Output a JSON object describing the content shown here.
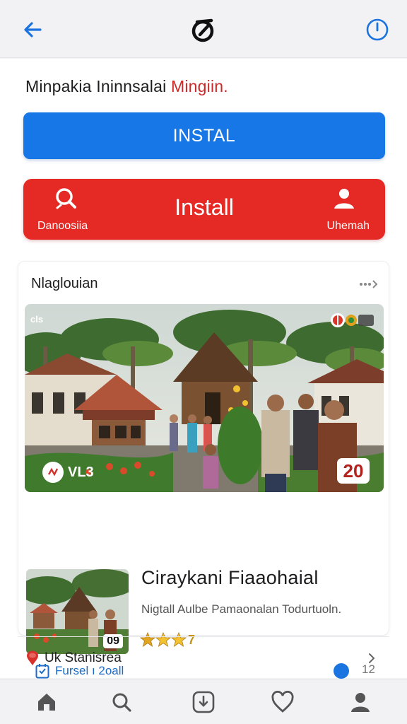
{
  "header": {
    "back_icon": "arrow-left-icon",
    "logo_icon": "brand-logo-icon",
    "power_icon": "power-icon",
    "accent_color": "#1877e6"
  },
  "headline": {
    "text": "Minpakia Ininnsalai",
    "accent": "Mingiin."
  },
  "install_primary": {
    "label": "INSTAL"
  },
  "install_secondary": {
    "label": "Install",
    "left_label": "Danoosiia",
    "right_label": "Uhemah",
    "left_icon": "search-icon",
    "right_icon": "user-icon",
    "color": "#e52a25"
  },
  "card": {
    "title": "Nlaglouian",
    "more_icon": "more-icon",
    "hero": {
      "badge_left": "VL3",
      "badge_right": "20",
      "corner_left": "cls"
    },
    "item": {
      "title": "Ciraykani Fiaaohaial",
      "subtitle": "Nigtall Aulbe Pamaonalan Todurtuoln.",
      "rating_text": "7",
      "stars": 3,
      "thumb_label": "09",
      "date_label": "Fursel ı 2oall",
      "count_label": "12"
    }
  },
  "list_row": {
    "label": "Uk Stanisrea"
  },
  "bottom_nav": {
    "items": [
      "home-icon",
      "search-icon",
      "download-icon",
      "heart-icon",
      "profile-icon"
    ]
  }
}
